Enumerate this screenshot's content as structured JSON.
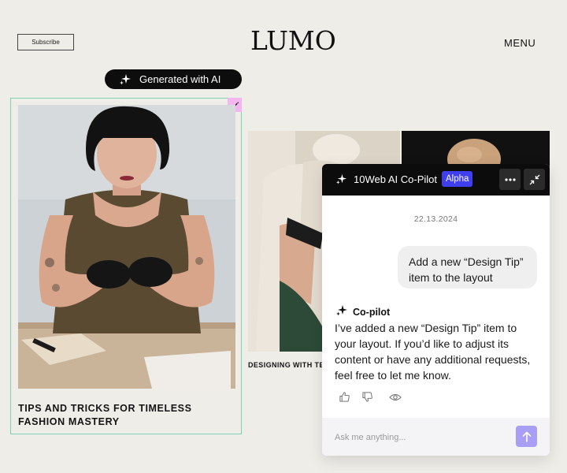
{
  "header": {
    "subscribe_label": "Subscribe",
    "logo_text": "LUMO",
    "menu_label": "MENU"
  },
  "ai_badge": {
    "label": "Generated with AI",
    "icon": "sparkle-icon"
  },
  "cards": [
    {
      "title": "TIPS AND TRICKS FOR TIMELESS FASHION MASTERY",
      "edit_icon": "pencil-icon"
    },
    {
      "title": "DESIGNING WITH TEXTILES: FABRICS AND MATERIALS IN FASHION"
    }
  ],
  "copilot": {
    "title": "10Web AI Co-Pilot",
    "badge": "Alpha",
    "more_icon": "more-dots-icon",
    "collapse_icon": "collapse-icon",
    "date": "22.13.2024",
    "user_message": "Add a new “Design Tip” item to the layout",
    "bot_name": "Co-pilot",
    "bot_message": "I’ve added a new “Design Tip” item to your layout. If you’d like to adjust its content or have any additional requests, feel free to let me know.",
    "feedback_icons": [
      "thumbs-up-icon",
      "thumbs-down-icon",
      "eye-icon"
    ],
    "input_placeholder": "Ask me anything...",
    "send_icon": "arrow-up-icon"
  },
  "colors": {
    "page_bg": "#efede8",
    "card_border": "#7bd3b3",
    "alpha_badge": "#3f3ff0",
    "send_button": "#a99ef5",
    "edit_icon_bg": "#f3b6ef"
  }
}
